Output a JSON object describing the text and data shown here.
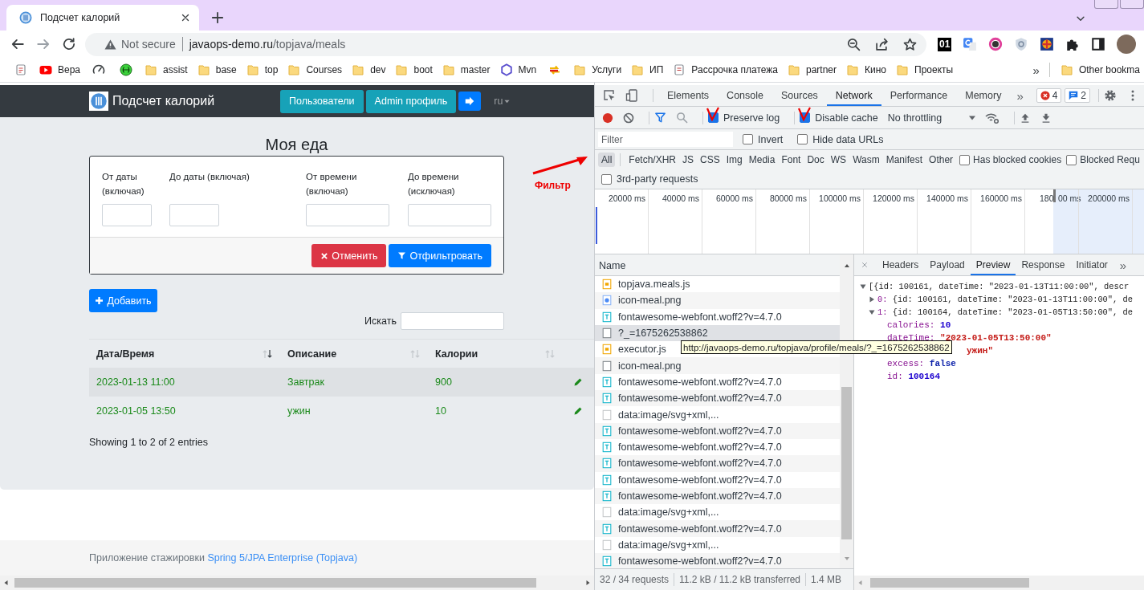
{
  "browser": {
    "tab": {
      "title": "Подсчет калорий",
      "selected": true
    },
    "address": {
      "security": "Not secure",
      "host": "javaops-demo.ru",
      "path": "/topjava/meals"
    },
    "extension_badge": "01",
    "bookmarks": [
      {
        "kind": "apps"
      },
      {
        "kind": "youtube",
        "label": "Вера"
      },
      {
        "kind": "gauge"
      },
      {
        "kind": "globe"
      },
      {
        "kind": "folder",
        "label": "assist"
      },
      {
        "kind": "folder",
        "label": "base"
      },
      {
        "kind": "folder",
        "label": "top"
      },
      {
        "kind": "folder",
        "label": "Courses"
      },
      {
        "kind": "folder",
        "label": "dev"
      },
      {
        "kind": "folder",
        "label": "boot"
      },
      {
        "kind": "folder",
        "label": "master"
      },
      {
        "kind": "hexagon",
        "label": "Mvn"
      },
      {
        "kind": "arrows"
      },
      {
        "kind": "folder",
        "label": "Услуги"
      },
      {
        "kind": "folder",
        "label": "ИП"
      },
      {
        "kind": "page",
        "label": "Рассрочка платежа"
      },
      {
        "kind": "folder",
        "label": "partner"
      },
      {
        "kind": "folder",
        "label": "Кино"
      },
      {
        "kind": "folder",
        "label": "Проекты"
      }
    ],
    "bookmarks_overflow": "»",
    "other_bookmarks": "Other bookma"
  },
  "page": {
    "brand": "Подсчет калорий",
    "nav_buttons": [
      {
        "kind": "info",
        "label": "Пользователи"
      },
      {
        "kind": "info",
        "label": "Admin профиль"
      },
      {
        "kind": "logout"
      }
    ],
    "language": "ru",
    "title": "Моя еда",
    "filter": {
      "fields": [
        {
          "label": "От даты (включая)",
          "kind": "date"
        },
        {
          "label": "До даты (включая)",
          "kind": "date"
        },
        {
          "label": "От времени (включая)",
          "kind": "time"
        },
        {
          "label": "До времени (исключая)",
          "kind": "time"
        }
      ],
      "cancel": "Отменить",
      "apply": "Отфильтровать"
    },
    "add_button": "Добавить",
    "search_label": "Искать",
    "table": {
      "columns": [
        {
          "label": "Дата/Время",
          "sorted": true
        },
        {
          "label": "Описание",
          "sorted": false
        },
        {
          "label": "Калории",
          "sorted": false
        }
      ],
      "rows": [
        {
          "date_time": "2023-01-13 11:00",
          "description": "Завтрак",
          "calories": "900",
          "excess": false
        },
        {
          "date_time": "2023-01-05 13:50",
          "description": "ужин",
          "calories": "10",
          "excess": false
        }
      ]
    },
    "info": "Showing 1 to 2 of 2 entries",
    "footer": {
      "text": "Приложение стажировки",
      "link": "Spring 5/JPA Enterprise (Topjava)"
    }
  },
  "annotation": {
    "text": "Фильтр"
  },
  "devtools": {
    "tabs": [
      {
        "label": "Elements",
        "selected": false
      },
      {
        "label": "Console",
        "selected": false
      },
      {
        "label": "Sources",
        "selected": false
      },
      {
        "label": "Network",
        "selected": true
      },
      {
        "label": "Performance",
        "selected": false
      },
      {
        "label": "Memory",
        "selected": false
      }
    ],
    "tabs_overflow": "»",
    "errors": "4",
    "messages": "2",
    "preserve_log": {
      "label": "Preserve log",
      "checked": true
    },
    "disable_cache": {
      "label": "Disable cache",
      "checked": true
    },
    "throttling": "No throttling",
    "filter": {
      "placeholder": "Filter"
    },
    "invert": {
      "label": "Invert",
      "checked": false
    },
    "hide_data_urls": {
      "label": "Hide data URLs",
      "checked": false
    },
    "types": [
      {
        "label": "All",
        "selected": true
      },
      {
        "label": "Fetch/XHR",
        "selected": false
      },
      {
        "label": "JS",
        "selected": false
      },
      {
        "label": "CSS",
        "selected": false
      },
      {
        "label": "Img",
        "selected": false
      },
      {
        "label": "Media",
        "selected": false
      },
      {
        "label": "Font",
        "selected": false
      },
      {
        "label": "Doc",
        "selected": false
      },
      {
        "label": "WS",
        "selected": false
      },
      {
        "label": "Wasm",
        "selected": false
      },
      {
        "label": "Manifest",
        "selected": false
      },
      {
        "label": "Other",
        "selected": false
      }
    ],
    "blocked_cookies": {
      "label": "Has blocked cookies",
      "checked": false
    },
    "blocked_requests": {
      "label": "Blocked Requ",
      "checked": false
    },
    "third_party": {
      "label": "3rd-party requests",
      "checked": false
    },
    "overview": {
      "ticks": [
        {
          "label": "20000 ms",
          "kind": "full"
        },
        {
          "label": "40000 ms",
          "kind": "full"
        },
        {
          "label": "60000 ms",
          "kind": "full"
        },
        {
          "label": "80000 ms",
          "kind": "full"
        },
        {
          "label": "100000 ms",
          "kind": "full"
        },
        {
          "label": "120000 ms",
          "kind": "full"
        },
        {
          "label": "140000 ms",
          "kind": "full"
        },
        {
          "label": "160000 ms",
          "kind": "full"
        },
        {
          "label": "180",
          "kind": "partial"
        },
        {
          "label": "200000 ms",
          "kind": "full"
        }
      ],
      "selection_label": "00 ms"
    },
    "requests": {
      "header": "Name",
      "rows": [
        {
          "name": "topjava.meals.js",
          "kind": "script",
          "selected": false
        },
        {
          "name": "icon-meal.png",
          "kind": "image",
          "selected": false
        },
        {
          "name": "fontawesome-webfont.woff2?v=4.7.0",
          "kind": "font",
          "selected": false
        },
        {
          "name": "?_=1675262538862",
          "kind": "document",
          "selected": true
        },
        {
          "name": "executor.js",
          "kind": "script",
          "selected": false
        },
        {
          "name": "icon-meal.png",
          "kind": "document",
          "selected": false
        },
        {
          "name": "fontawesome-webfont.woff2?v=4.7.0",
          "kind": "font",
          "selected": false
        },
        {
          "name": "fontawesome-webfont.woff2?v=4.7.0",
          "kind": "font",
          "selected": false
        },
        {
          "name": "data:image/svg+xml,...",
          "kind": "data",
          "selected": false
        },
        {
          "name": "fontawesome-webfont.woff2?v=4.7.0",
          "kind": "font",
          "selected": false
        },
        {
          "name": "fontawesome-webfont.woff2?v=4.7.0",
          "kind": "font",
          "selected": false
        },
        {
          "name": "fontawesome-webfont.woff2?v=4.7.0",
          "kind": "font",
          "selected": false
        },
        {
          "name": "fontawesome-webfont.woff2?v=4.7.0",
          "kind": "font",
          "selected": false
        },
        {
          "name": "fontawesome-webfont.woff2?v=4.7.0",
          "kind": "font",
          "selected": false
        },
        {
          "name": "data:image/svg+xml,...",
          "kind": "data",
          "selected": false
        },
        {
          "name": "fontawesome-webfont.woff2?v=4.7.0",
          "kind": "font",
          "selected": false
        },
        {
          "name": "data:image/svg+xml,...",
          "kind": "data",
          "selected": false
        },
        {
          "name": "fontawesome-webfont.woff2?v=4.7.0",
          "kind": "font",
          "selected": false
        }
      ]
    },
    "tooltip": "http://javaops-demo.ru/topjava/profile/meals/?_=1675262538862",
    "detail_tabs": [
      {
        "label": "Headers",
        "selected": false
      },
      {
        "label": "Payload",
        "selected": false
      },
      {
        "label": "Preview",
        "selected": true
      },
      {
        "label": "Response",
        "selected": false
      },
      {
        "label": "Initiator",
        "selected": false
      }
    ],
    "detail_tabs_overflow": "»",
    "preview": [
      {
        "kind": "summary",
        "expanded": true,
        "text": "[{id: 100161, dateTime: \"2023-01-13T11:00:00\", descr"
      },
      {
        "kind": "summary",
        "expanded": false,
        "key": "0:",
        "text": "{id: 100161, dateTime: \"2023-01-13T11:00:00\", de"
      },
      {
        "kind": "summary",
        "expanded": true,
        "key": "1:",
        "text": "{id: 100164, dateTime: \"2023-01-05T13:50:00\", de"
      },
      {
        "kind": "prop",
        "key": "calories:",
        "value": "10",
        "color": "#1c00cf"
      },
      {
        "kind": "prop",
        "key": "dateTime:",
        "value": "\"2023-01-05T13:50:00\"",
        "color": "#c41a16"
      },
      {
        "kind": "tail",
        "value": "ужин\"",
        "color": "#c41a16"
      },
      {
        "kind": "prop",
        "key": "excess:",
        "value": "false",
        "color": "#0d22aa"
      },
      {
        "kind": "prop",
        "key": "id:",
        "value": "100164",
        "color": "#1c00cf"
      }
    ],
    "status": [
      "32 / 34 requests",
      "11.2 kB / 11.2 kB transferred",
      "1.4 MB"
    ]
  }
}
